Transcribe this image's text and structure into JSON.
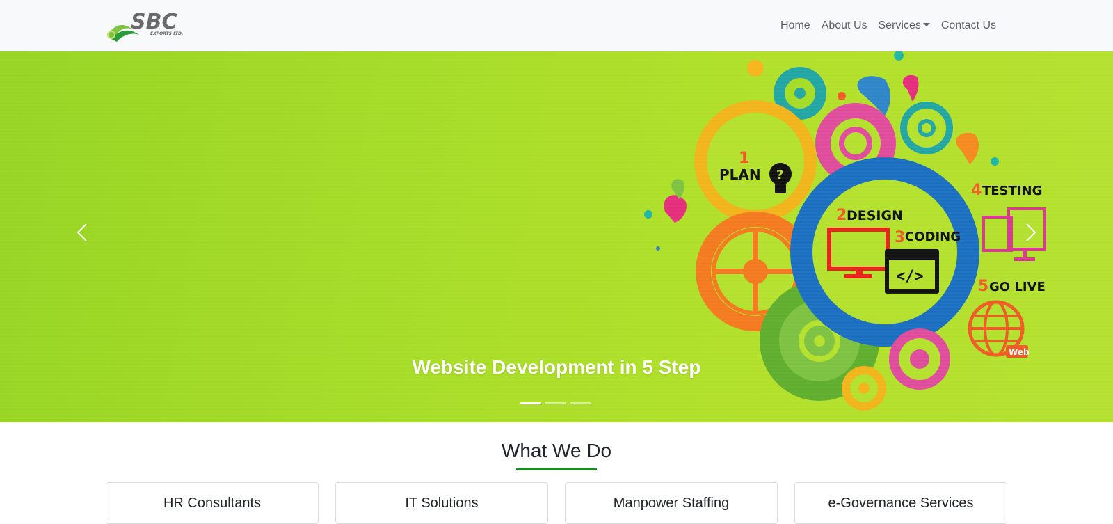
{
  "brand": {
    "logo_text": "SBC",
    "logo_subtext": "EXPORTS LTD."
  },
  "nav": {
    "items": [
      {
        "label": "Home"
      },
      {
        "label": "About Us"
      },
      {
        "label": "Services",
        "has_dropdown": true
      },
      {
        "label": "Contact Us"
      }
    ]
  },
  "carousel": {
    "caption": "Website Development in 5 Step",
    "active_slide": 1,
    "slide_count": 3,
    "graphic_labels": {
      "step1_num": "1",
      "step1": "PLAN",
      "step2_num": "2",
      "step2": "DESIGN",
      "step3_num": "3",
      "step3": "CODING",
      "step4_num": "4",
      "step4": "TESTING",
      "step5_num": "5",
      "step5": "GO LIVE",
      "code": "</>",
      "web": "Web"
    }
  },
  "section": {
    "title": "What We Do",
    "cards": [
      {
        "label": "HR Consultants"
      },
      {
        "label": "IT Solutions"
      },
      {
        "label": "Manpower Staffing"
      },
      {
        "label": "e-Governance Services"
      }
    ]
  },
  "colors": {
    "navbar_bg": "#f8f9fa",
    "hero_green": "#a5dc27",
    "accent_green": "#1e8a26"
  }
}
